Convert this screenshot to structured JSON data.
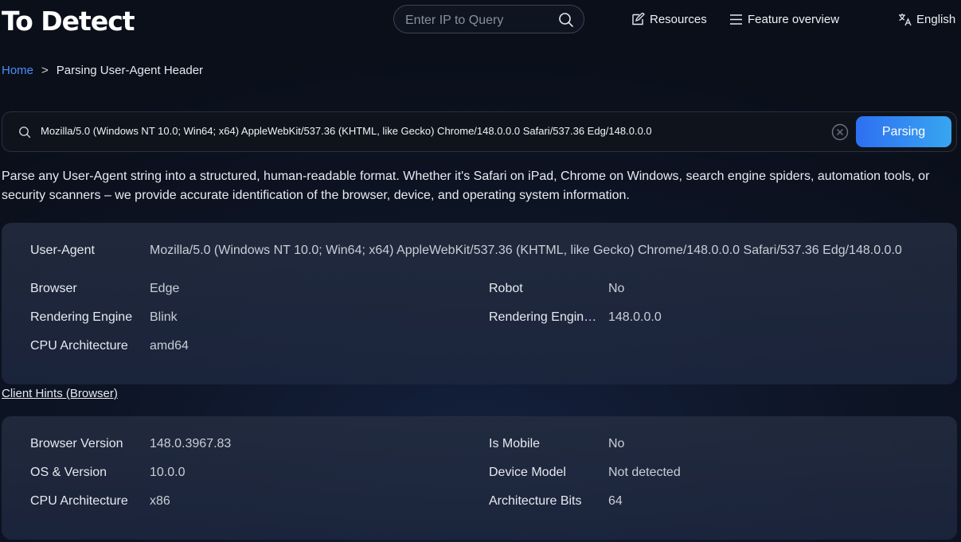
{
  "header": {
    "logo_text": "To Detect",
    "ip_search": {
      "placeholder": "Enter IP to Query",
      "value": ""
    },
    "nav": {
      "resources": "Resources",
      "feature_overview": "Feature overview",
      "language": "English"
    }
  },
  "breadcrumb": {
    "home": "Home",
    "separator": ">",
    "current": "Parsing User-Agent Header"
  },
  "ua_input": {
    "value": "Mozilla/5.0 (Windows NT 10.0; Win64; x64) AppleWebKit/537.36 (KHTML, like Gecko) Chrome/148.0.0.0 Safari/537.36 Edg/148.0.0.0",
    "button": "Parsing"
  },
  "description": "Parse any User-Agent string into a structured, human-readable format. Whether it's Safari on iPad, Chrome on Windows, search engine spiders, automation tools, or security scanners – we provide accurate identification of the browser, device, and operating system information.",
  "result": {
    "user_agent": {
      "label": "User-Agent",
      "value": "Mozilla/5.0 (Windows NT 10.0; Win64; x64) AppleWebKit/537.36 (KHTML, like Gecko) Chrome/148.0.0.0 Safari/537.36 Edg/148.0.0.0"
    },
    "browser": {
      "label": "Browser",
      "value": "Edge"
    },
    "robot": {
      "label": "Robot",
      "value": "No"
    },
    "rendering_engine": {
      "label": "Rendering Engine",
      "value": "Blink"
    },
    "rendering_engine_version": {
      "label": "Rendering Engine Version",
      "value": "148.0.0.0"
    },
    "cpu_architecture": {
      "label": "CPU Architecture",
      "value": "amd64"
    }
  },
  "client_hints": {
    "link": "Client Hints (Browser)",
    "browser_version": {
      "label": "Browser Version",
      "value": "148.0.3967.83"
    },
    "is_mobile": {
      "label": "Is Mobile",
      "value": "No"
    },
    "os_version": {
      "label": "OS & Version",
      "value": "10.0.0"
    },
    "device_model": {
      "label": "Device Model",
      "value": "Not detected"
    },
    "cpu_architecture": {
      "label": "CPU Architecture",
      "value": "x86"
    },
    "architecture_bits": {
      "label": "Architecture Bits",
      "value": "64"
    }
  },
  "colors": {
    "accent": "#2e6ff2",
    "link": "#4b8ef5",
    "background": "#0b1019"
  }
}
